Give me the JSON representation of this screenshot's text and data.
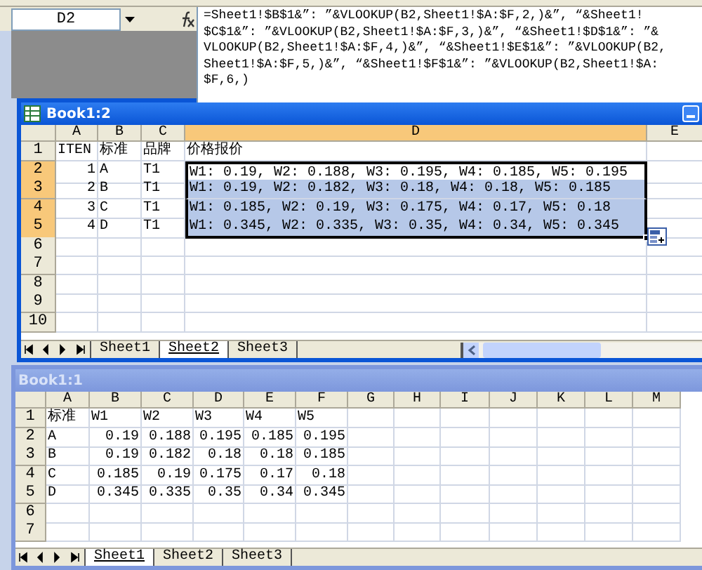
{
  "formula_bar": {
    "name_box": "D2",
    "formula_lines": [
      "=Sheet1!$B$1&”: ”&VLOOKUP(B2,Sheet1!$A:$F,2,)&”, “&Sheet1!",
      "$C$1&”: ”&VLOOKUP(B2,Sheet1!$A:$F,3,)&”, “&Sheet1!$D$1&”: ”&",
      "VLOOKUP(B2,Sheet1!$A:$F,4,)&”, “&Sheet1!$E$1&”: ”&VLOOKUP(B2,",
      "Sheet1!$A:$F,5,)&”, “&Sheet1!$F$1&”: ”&VLOOKUP(B2,Sheet1!$A:",
      "$F,6,)"
    ]
  },
  "windows": [
    {
      "title": "Book1:2",
      "active": true,
      "columns": [
        {
          "label": "A",
          "selected": false
        },
        {
          "label": "B",
          "selected": false
        },
        {
          "label": "C",
          "selected": false
        },
        {
          "label": "D",
          "selected": true
        },
        {
          "label": "E",
          "selected": false
        }
      ],
      "rows": [
        {
          "header": "1",
          "selected": false,
          "cells": [
            {
              "text": "ITEN",
              "kind": "text",
              "selected": false,
              "active": false
            },
            {
              "text": "标准",
              "kind": "text",
              "selected": false,
              "active": false
            },
            {
              "text": "品牌",
              "kind": "text",
              "selected": false,
              "active": false
            },
            {
              "text": "价格报价",
              "kind": "text",
              "selected": false,
              "active": false
            }
          ]
        },
        {
          "header": "2",
          "selected": true,
          "cells": [
            {
              "text": "1",
              "kind": "number",
              "selected": false,
              "active": false
            },
            {
              "text": "A",
              "kind": "text",
              "selected": false,
              "active": false
            },
            {
              "text": "T1",
              "kind": "text",
              "selected": false,
              "active": false
            },
            {
              "text": "W1: 0.19, W2: 0.188, W3: 0.195, W4: 0.185, W5: 0.195",
              "kind": "text",
              "selected": true,
              "active": true
            }
          ]
        },
        {
          "header": "3",
          "selected": true,
          "cells": [
            {
              "text": "2",
              "kind": "number",
              "selected": false,
              "active": false
            },
            {
              "text": "B",
              "kind": "text",
              "selected": false,
              "active": false
            },
            {
              "text": "T1",
              "kind": "text",
              "selected": false,
              "active": false
            },
            {
              "text": "W1: 0.19, W2: 0.182, W3: 0.18, W4: 0.18, W5: 0.185",
              "kind": "text",
              "selected": true,
              "active": false
            }
          ]
        },
        {
          "header": "4",
          "selected": true,
          "cells": [
            {
              "text": "3",
              "kind": "number",
              "selected": false,
              "active": false
            },
            {
              "text": "C",
              "kind": "text",
              "selected": false,
              "active": false
            },
            {
              "text": "T1",
              "kind": "text",
              "selected": false,
              "active": false
            },
            {
              "text": "W1: 0.185, W2: 0.19, W3: 0.175, W4: 0.17, W5: 0.18",
              "kind": "text",
              "selected": true,
              "active": false
            }
          ]
        },
        {
          "header": "5",
          "selected": true,
          "cells": [
            {
              "text": "4",
              "kind": "number",
              "selected": false,
              "active": false
            },
            {
              "text": "D",
              "kind": "text",
              "selected": false,
              "active": false
            },
            {
              "text": "T1",
              "kind": "text",
              "selected": false,
              "active": false
            },
            {
              "text": "W1: 0.345, W2: 0.335, W3: 0.35, W4: 0.34, W5: 0.345",
              "kind": "text",
              "selected": true,
              "active": false
            }
          ]
        },
        {
          "header": "6",
          "selected": false
        },
        {
          "header": "7",
          "selected": false
        },
        {
          "header": "8",
          "selected": false
        },
        {
          "header": "9",
          "selected": false
        },
        {
          "header": "10",
          "selected": false
        }
      ],
      "sheet_tabs": [
        {
          "label": "Sheet1",
          "selected": false
        },
        {
          "label": "Sheet2",
          "selected": true
        },
        {
          "label": "Sheet3",
          "selected": false
        }
      ],
      "paste_options": true
    },
    {
      "title": "Book1:1",
      "active": false,
      "columns": [
        {
          "label": "A",
          "selected": false
        },
        {
          "label": "B",
          "selected": false
        },
        {
          "label": "C",
          "selected": false
        },
        {
          "label": "D",
          "selected": false
        },
        {
          "label": "E",
          "selected": false
        },
        {
          "label": "F",
          "selected": false
        },
        {
          "label": "G",
          "selected": false
        },
        {
          "label": "H",
          "selected": false
        },
        {
          "label": "I",
          "selected": false
        },
        {
          "label": "J",
          "selected": false
        },
        {
          "label": "K",
          "selected": false
        },
        {
          "label": "L",
          "selected": false
        },
        {
          "label": "M",
          "selected": false
        }
      ],
      "rows": [
        {
          "header": "1",
          "selected": false,
          "cells": [
            {
              "text": "标准",
              "kind": "text"
            },
            {
              "text": "W1",
              "kind": "text"
            },
            {
              "text": "W2",
              "kind": "text"
            },
            {
              "text": "W3",
              "kind": "text"
            },
            {
              "text": "W4",
              "kind": "text"
            },
            {
              "text": "W5",
              "kind": "text"
            }
          ]
        },
        {
          "header": "2",
          "selected": false,
          "cells": [
            {
              "text": "A",
              "kind": "text"
            },
            {
              "text": "0.19",
              "kind": "number"
            },
            {
              "text": "0.188",
              "kind": "number"
            },
            {
              "text": "0.195",
              "kind": "number"
            },
            {
              "text": "0.185",
              "kind": "number"
            },
            {
              "text": "0.195",
              "kind": "number"
            }
          ]
        },
        {
          "header": "3",
          "selected": false,
          "cells": [
            {
              "text": "B",
              "kind": "text"
            },
            {
              "text": "0.19",
              "kind": "number"
            },
            {
              "text": "0.182",
              "kind": "number"
            },
            {
              "text": "0.18",
              "kind": "number"
            },
            {
              "text": "0.18",
              "kind": "number"
            },
            {
              "text": "0.185",
              "kind": "number"
            }
          ]
        },
        {
          "header": "4",
          "selected": false,
          "cells": [
            {
              "text": "C",
              "kind": "text"
            },
            {
              "text": "0.185",
              "kind": "number"
            },
            {
              "text": "0.19",
              "kind": "number"
            },
            {
              "text": "0.175",
              "kind": "number"
            },
            {
              "text": "0.17",
              "kind": "number"
            },
            {
              "text": "0.18",
              "kind": "number"
            }
          ]
        },
        {
          "header": "5",
          "selected": false,
          "cells": [
            {
              "text": "D",
              "kind": "text"
            },
            {
              "text": "0.345",
              "kind": "number"
            },
            {
              "text": "0.335",
              "kind": "number"
            },
            {
              "text": "0.35",
              "kind": "number"
            },
            {
              "text": "0.34",
              "kind": "number"
            },
            {
              "text": "0.345",
              "kind": "number"
            }
          ]
        },
        {
          "header": "6",
          "selected": false
        },
        {
          "header": "7",
          "selected": false
        }
      ],
      "sheet_tabs": [
        {
          "label": "Sheet1",
          "selected": true
        },
        {
          "label": "Sheet2",
          "selected": false
        },
        {
          "label": "Sheet3",
          "selected": false
        }
      ]
    }
  ]
}
